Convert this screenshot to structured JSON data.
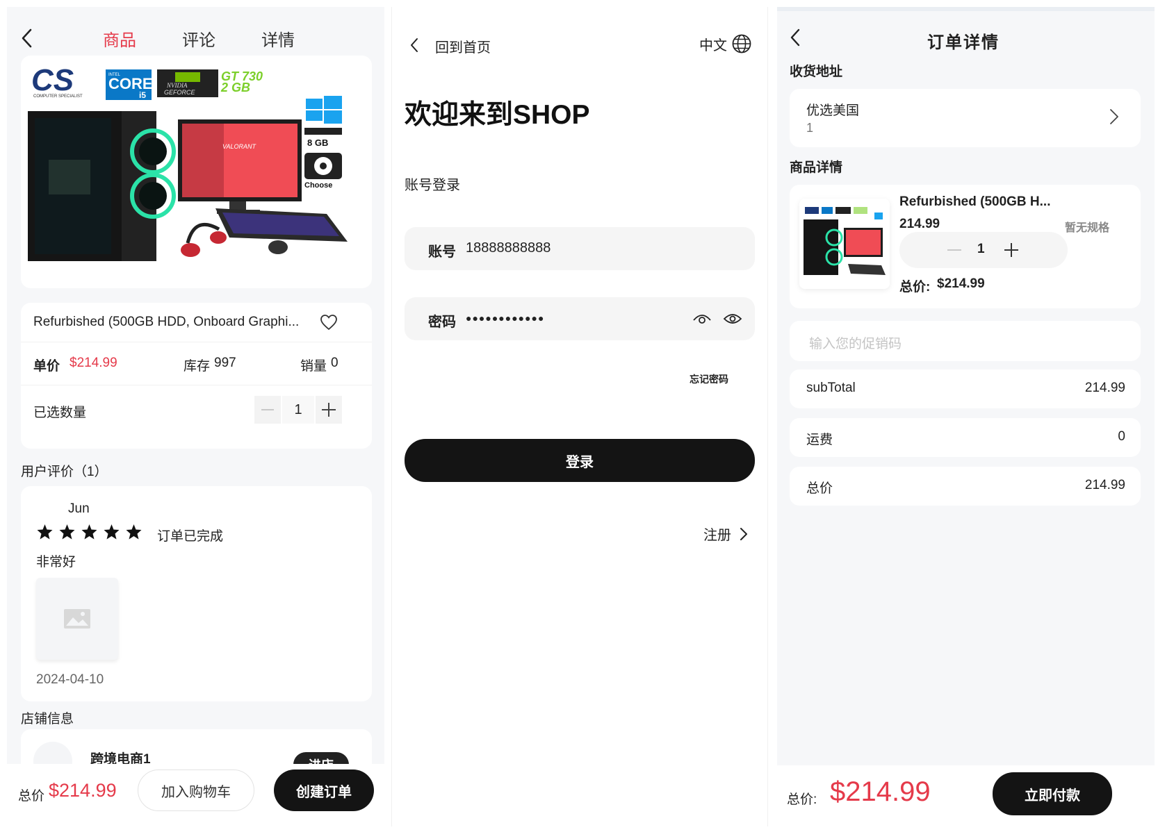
{
  "product_page": {
    "tabs": [
      "商品",
      "评论",
      "详情"
    ],
    "active_tab": 0,
    "image_badges": {
      "cs_logo": "CS",
      "cs_sub": "COMPUTER SPECIALIST",
      "intel_top": "INTEL",
      "intel_core": "CORE",
      "intel_i5": "i5",
      "nvidia_line1": "NVIDIA",
      "nvidia_line2": "GEFORCE",
      "gt730": "GT 730",
      "gt730_mem": "2 GB",
      "ram": "8 GB",
      "hdd": "Choose",
      "monitor_text": "VALORANT"
    },
    "title": "Refurbished (500GB HDD, Onboard Graphi...",
    "price_label": "单价",
    "price": "$214.99",
    "stock_label": "库存",
    "stock": "997",
    "sales_label": "销量",
    "sales": "0",
    "qty_label": "已选数量",
    "qty": "1",
    "reviews_header": "用户评价",
    "reviews_count": "（1）",
    "review": {
      "user": "Jun",
      "rating": 5,
      "status": "订单已完成",
      "text": "非常好",
      "date": "2024-04-10"
    },
    "store_header": "店铺信息",
    "store_name": "跨境电商1",
    "store_button": "进店",
    "total_label": "总价",
    "total": "$214.99",
    "add_cart": "加入购物车",
    "create_order": "创建订单"
  },
  "login_page": {
    "back_label": "回到首页",
    "language": "中文",
    "welcome": "欢迎来到SHOP",
    "subtitle": "账号登录",
    "account_label": "账号",
    "account_value": "18888888888",
    "password_label": "密码",
    "password_value": "●●●●●●●●●●●●",
    "forgot": "忘记密码",
    "login_button": "登录",
    "register": "注册"
  },
  "order_page": {
    "title": "订单详情",
    "address_header": "收货地址",
    "address_name": "优选美国",
    "address_sub": "1",
    "goods_header": "商品详情",
    "item_title": "Refurbished (500GB H...",
    "item_price": "214.99",
    "item_spec": "暂无规格",
    "item_qty": "1",
    "item_total_label": "总价:",
    "item_total": "$214.99",
    "promo_placeholder": "输入您的促销码",
    "subtotal_label": "subTotal",
    "subtotal": "214.99",
    "shipping_label": "运费",
    "shipping": "0",
    "total_label": "总价",
    "total": "214.99",
    "bottom_total_label": "总价:",
    "bottom_total": "$214.99",
    "pay_button": "立即付款"
  },
  "colors": {
    "accent_red": "#e53a4a",
    "dark": "#141414",
    "bg": "#f6f7f9"
  }
}
